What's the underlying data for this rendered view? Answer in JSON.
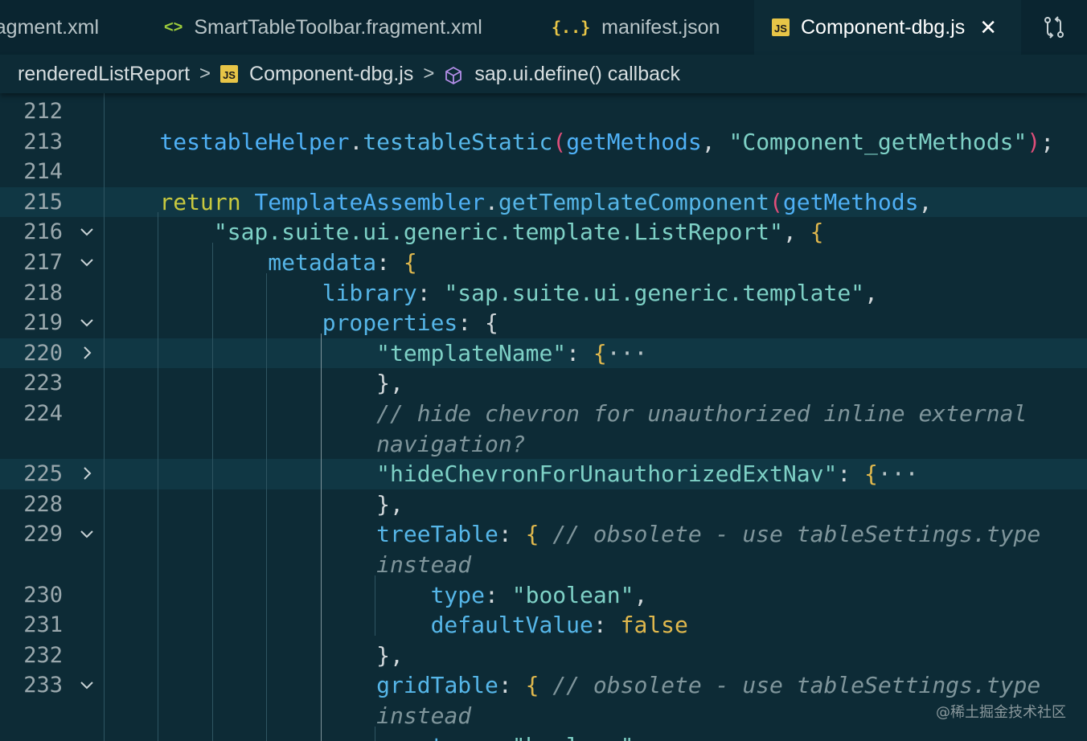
{
  "tabs": [
    {
      "name": "tab-fragment-xml",
      "label": "agment.xml",
      "icon": "xml-file-icon",
      "active": false
    },
    {
      "name": "tab-smarttabletoolbar",
      "label": "SmartTableToolbar.fragment.xml",
      "icon": "xml-file-icon",
      "icon_text": "<>",
      "active": false
    },
    {
      "name": "tab-manifest",
      "label": "manifest.json",
      "icon": "json-file-icon",
      "icon_text": "{..}",
      "active": false
    },
    {
      "name": "tab-component-dbg",
      "label": "Component-dbg.js",
      "icon": "js-file-icon",
      "icon_text": "JS",
      "active": true
    }
  ],
  "tab_close_icon": "close-icon",
  "tab_action_icon": "source-control-compare-icon",
  "breadcrumb": {
    "items": [
      "renderedListReport",
      "Component-dbg.js",
      "sap.ui.define() callback"
    ],
    "icons": [
      "js-file-icon",
      "cube-icon"
    ],
    "js_icon_text": "JS"
  },
  "editor": {
    "line_numbers": [
      "212",
      "213",
      "214",
      "215",
      "216",
      "217",
      "218",
      "219",
      "220",
      "223",
      "224",
      "",
      "225",
      "228",
      "229",
      "",
      "230",
      "231",
      "232",
      "233",
      "",
      ""
    ],
    "code": [
      [],
      [
        [
          "    ",
          ""
        ],
        [
          "testableHelper",
          "var"
        ],
        [
          ".",
          ""
        ],
        [
          "testableStatic",
          "fn"
        ],
        [
          "(",
          "paren"
        ],
        [
          "getMethods",
          "var"
        ],
        [
          ", ",
          ""
        ],
        [
          "\"Component_getMethods\"",
          "str"
        ],
        [
          ")",
          "paren"
        ],
        [
          ";",
          ""
        ]
      ],
      [],
      [
        [
          "    ",
          ""
        ],
        [
          "return",
          "kw"
        ],
        [
          " ",
          ""
        ],
        [
          "TemplateAssembler",
          "var"
        ],
        [
          ".",
          ""
        ],
        [
          "getTemplateComponent",
          "fn"
        ],
        [
          "(",
          "paren"
        ],
        [
          "getMethods",
          "var"
        ],
        [
          ",",
          ""
        ]
      ],
      [
        [
          "        ",
          ""
        ],
        [
          "\"sap.suite.ui.generic.template.ListReport\"",
          "str"
        ],
        [
          ", ",
          ""
        ],
        [
          "{",
          "brace"
        ]
      ],
      [
        [
          "            ",
          ""
        ],
        [
          "metadata",
          "prop"
        ],
        [
          ": ",
          ""
        ],
        [
          "{",
          "brace"
        ]
      ],
      [
        [
          "                ",
          ""
        ],
        [
          "library",
          "prop"
        ],
        [
          ": ",
          ""
        ],
        [
          "\"sap.suite.ui.generic.template\"",
          "str"
        ],
        [
          ",",
          ""
        ]
      ],
      [
        [
          "                ",
          ""
        ],
        [
          "properties",
          "prop"
        ],
        [
          ": ",
          ""
        ],
        [
          "{",
          ""
        ]
      ],
      [
        [
          "                    ",
          ""
        ],
        [
          "\"templateName\"",
          "str"
        ],
        [
          ": ",
          ""
        ],
        [
          "{",
          "brace"
        ],
        [
          "···",
          "fold"
        ]
      ],
      [
        [
          "                    ",
          ""
        ],
        [
          "},",
          ""
        ]
      ],
      [
        [
          "                    ",
          ""
        ],
        [
          "// hide chevron for unauthorized inline external",
          "comment"
        ]
      ],
      [
        [
          "                    ",
          ""
        ],
        [
          "navigation?",
          "comment"
        ]
      ],
      [
        [
          "                    ",
          ""
        ],
        [
          "\"hideChevronForUnauthorizedExtNav\"",
          "str"
        ],
        [
          ": ",
          ""
        ],
        [
          "{",
          "brace"
        ],
        [
          "···",
          "fold"
        ]
      ],
      [
        [
          "                    ",
          ""
        ],
        [
          "},",
          ""
        ]
      ],
      [
        [
          "                    ",
          ""
        ],
        [
          "treeTable",
          "prop"
        ],
        [
          ": ",
          ""
        ],
        [
          "{",
          "brace"
        ],
        [
          " ",
          ""
        ],
        [
          "// obsolete - use tableSettings.type",
          "comment"
        ]
      ],
      [
        [
          "                    ",
          ""
        ],
        [
          "instead",
          "comment"
        ]
      ],
      [
        [
          "                        ",
          ""
        ],
        [
          "type",
          "prop"
        ],
        [
          ": ",
          ""
        ],
        [
          "\"boolean\"",
          "str"
        ],
        [
          ",",
          ""
        ]
      ],
      [
        [
          "                        ",
          ""
        ],
        [
          "defaultValue",
          "prop"
        ],
        [
          ": ",
          ""
        ],
        [
          "false",
          "bool"
        ]
      ],
      [
        [
          "                    ",
          ""
        ],
        [
          "},",
          ""
        ]
      ],
      [
        [
          "                    ",
          ""
        ],
        [
          "gridTable",
          "prop"
        ],
        [
          ": ",
          ""
        ],
        [
          "{",
          "brace"
        ],
        [
          " ",
          ""
        ],
        [
          "// obsolete - use tableSettings.type",
          "comment"
        ]
      ],
      [
        [
          "                    ",
          ""
        ],
        [
          "instead",
          "comment"
        ]
      ],
      [
        [
          "                        ",
          ""
        ],
        [
          "type",
          "prop"
        ],
        [
          ": ",
          ""
        ],
        [
          "\"boolean\"",
          "str"
        ],
        [
          ",",
          ""
        ]
      ]
    ],
    "folds": {
      "216": "expanded",
      "217": "expanded",
      "219": "expanded",
      "220": "collapsed",
      "225": "collapsed",
      "229": "expanded",
      "233": "expanded"
    },
    "highlighted_rows": [
      3,
      8,
      12
    ]
  },
  "watermark": "@稀土掘金技术社区"
}
